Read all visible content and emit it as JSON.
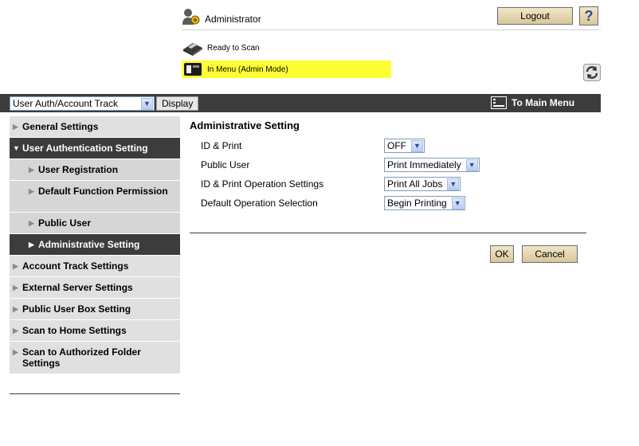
{
  "header": {
    "user_name": "Administrator",
    "logout_label": "Logout",
    "help_label": "?",
    "status_ready": "Ready to Scan",
    "status_menu": "In Menu (Admin Mode)",
    "status_menu_color": "#ffff33"
  },
  "topbar": {
    "mode_select_value": "User Auth/Account Track",
    "display_label": "Display",
    "main_menu_label": "To Main Menu"
  },
  "sidebar": {
    "items": [
      {
        "label": "General Settings"
      },
      {
        "label": "User Authentication Setting"
      },
      {
        "label": "User Registration"
      },
      {
        "label": "Default Function Permission"
      },
      {
        "label": "Public User"
      },
      {
        "label": "Administrative Setting"
      },
      {
        "label": "Account Track Settings"
      },
      {
        "label": "External Server Settings"
      },
      {
        "label": "Public User Box Setting"
      },
      {
        "label": "Scan to Home Settings"
      },
      {
        "label": "Scan to Authorized Folder Settings"
      }
    ]
  },
  "main": {
    "title": "Administrative Setting",
    "fields": [
      {
        "label": "ID & Print",
        "value": "OFF"
      },
      {
        "label": "Public User",
        "value": "Print Immediately"
      },
      {
        "label": "ID & Print Operation Settings",
        "value": "Print All Jobs"
      },
      {
        "label": "Default Operation Selection",
        "value": "Begin Printing"
      }
    ],
    "ok_label": "OK",
    "cancel_label": "Cancel"
  },
  "colors": {
    "dark_bar": "#3c3c3c",
    "nav_bg": "#e0e0e0",
    "button_bg": "#d9c79a"
  }
}
